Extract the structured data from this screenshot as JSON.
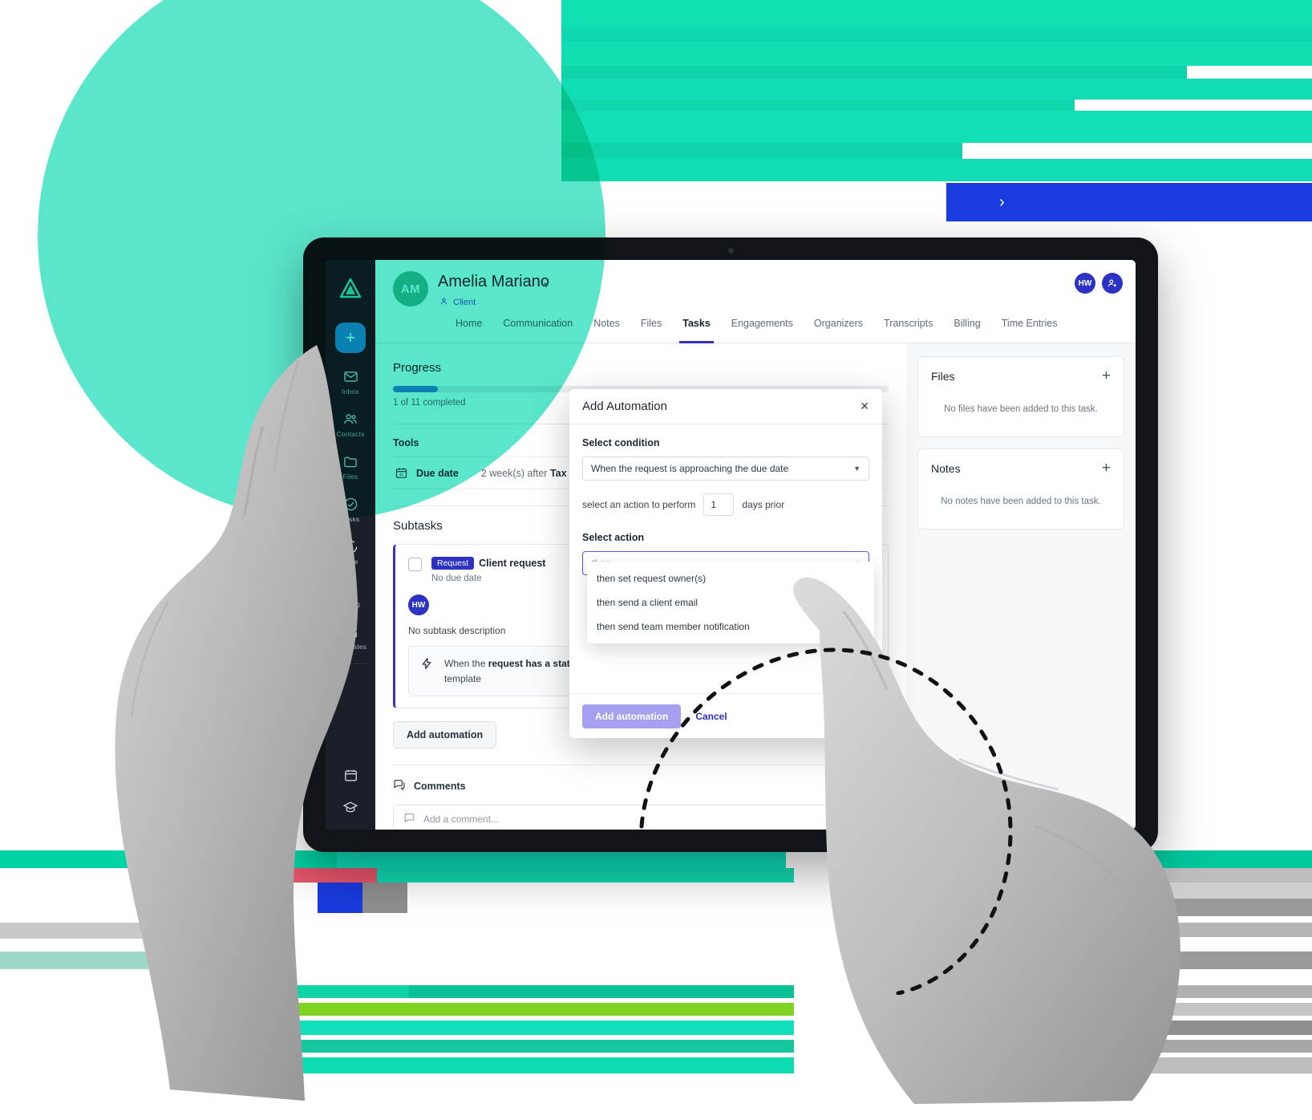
{
  "sidebar": {
    "logo_icon": "triangle-logo-icon",
    "add_button_label": "+",
    "items": [
      {
        "label": "Inbox",
        "icon": "envelope-icon"
      },
      {
        "label": "Contacts",
        "icon": "people-icon"
      },
      {
        "label": "Files",
        "icon": "folder-icon"
      },
      {
        "label": "Tasks",
        "icon": "check-circle-icon"
      },
      {
        "label": "Time",
        "icon": "clock-icon"
      },
      {
        "label": "Billing",
        "icon": "dollar-square-icon"
      },
      {
        "label": "Templates",
        "icon": "layout-grid-icon"
      }
    ],
    "bottom_items": [
      {
        "label": "",
        "icon": "calendar-icon"
      },
      {
        "label": "",
        "icon": "graduation-cap-icon"
      }
    ]
  },
  "header": {
    "avatar_initials": "AM",
    "client_name": "Amelia Mariano",
    "name_caret_icon": "chevron-down-icon",
    "role_icon": "person-icon",
    "role_label": "Client",
    "user_avatar_initials": "HW",
    "add_user_icon": "add-user-icon"
  },
  "tabs": [
    {
      "label": "Home",
      "active": false
    },
    {
      "label": "Communication",
      "active": false
    },
    {
      "label": "Notes",
      "active": false
    },
    {
      "label": "Files",
      "active": false
    },
    {
      "label": "Tasks",
      "active": true
    },
    {
      "label": "Engagements",
      "active": false
    },
    {
      "label": "Organizers",
      "active": false
    },
    {
      "label": "Transcripts",
      "active": false
    },
    {
      "label": "Billing",
      "active": false
    },
    {
      "label": "Time Entries",
      "active": false
    }
  ],
  "main": {
    "progress_title": "Progress",
    "progress_percent": 9,
    "progress_label": "1 of 11 completed",
    "tools_title": "Tools",
    "tool_row": {
      "icon": "calendar-31-icon",
      "name": "Due date",
      "value_prefix": "2 week(s) after ",
      "value_bold": "Tax P"
    },
    "subtasks_title": "Subtasks",
    "subtask": {
      "badge": "Request",
      "title": "Client request",
      "due": "No due date",
      "avatar_initials": "HW",
      "description": "No subtask description",
      "automation_icon": "lightning-bolt-icon",
      "automation_text_1": "When the ",
      "automation_bold": "request has a status o",
      "automation_text_2": "template"
    },
    "add_automation_button": "Add automation",
    "comments_title": "Comments",
    "comments_icon": "chat-bubbles-icon",
    "comment_placeholder": "Add a comment...",
    "comment_input_icon": "chat-icon",
    "comment_attach_icon": "paperclip-icon"
  },
  "side_panels": [
    {
      "title": "Files",
      "plus_icon": "plus-icon",
      "empty": "No files have been added to this task."
    },
    {
      "title": "Notes",
      "plus_icon": "plus-icon",
      "empty": "No notes have been added to this task."
    }
  ],
  "modal": {
    "title": "Add Automation",
    "close_icon": "close-icon",
    "condition_label": "Select condition",
    "condition_value": "When the request is approaching the due date",
    "condition_caret_icon": "chevron-down-icon",
    "inline_prefix": "select an action to perform",
    "days_value": "1",
    "inline_suffix": "days prior",
    "action_label": "Select action",
    "action_placeholder": "then...",
    "action_caret_icon": "chevron-down-icon",
    "options": [
      "then set request owner(s)",
      "then send a client email",
      "then send team member notification"
    ],
    "submit_label": "Add automation",
    "cancel_label": "Cancel"
  },
  "overlay": {
    "next_arrow_icon": "chevron-right-icon"
  },
  "colors": {
    "teal": "#18ddb5",
    "brand_blue": "#2b32c4",
    "accent_purple": "#a5a0f0",
    "sidebar_dark": "#1b2028",
    "progress_blue": "#1c8fe0"
  }
}
